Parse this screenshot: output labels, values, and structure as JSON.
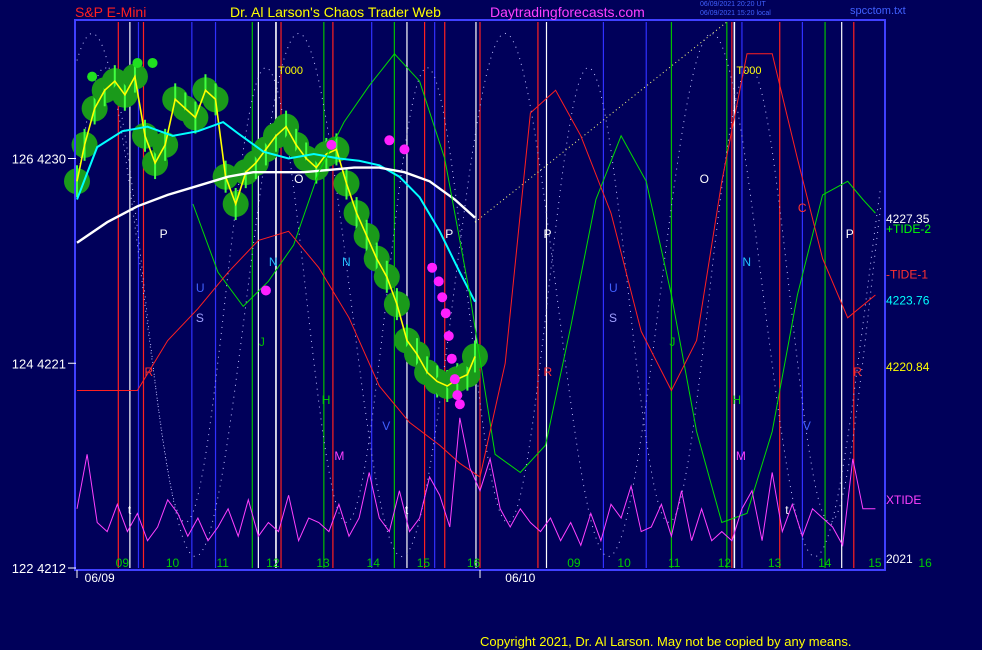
{
  "header": {
    "symbol": "S&P E-Mini",
    "site": "Dr. Al Larson's Chaos Trader Web",
    "url": "Daytradingforecasts.com",
    "file": "spcctom.txt",
    "stamp1": "06/09/2021 20:20 UT",
    "stamp2": "06/09/2021 15:20 local"
  },
  "copyright": "Copyright 2021, Dr. Al Larson. May not be copied by any means.",
  "colors": {
    "background": "#00005a",
    "frame": "#4040ff",
    "price": "#ffff00",
    "ma_fast": "#00ffff",
    "ma_slow": "#ffffff",
    "tide_plus": "#00dd00",
    "tide_minus": "#ff2020",
    "xtide": "#ff40ff",
    "highlight": "#00cc00"
  },
  "chart_data": {
    "type": "line",
    "title": "S&P E-Mini",
    "ylim": [
      4212,
      4236
    ],
    "y_ticks": [
      {
        "value": 4230,
        "label": "126  4230"
      },
      {
        "value": 4221,
        "label": "124  4221"
      },
      {
        "value": 4212,
        "label": "122  4212"
      }
    ],
    "x_hour_labels": [
      "09",
      "10",
      "11",
      "12",
      "13",
      "14",
      "15",
      "16",
      "09",
      "10",
      "11",
      "12",
      "13",
      "14",
      "15",
      "16"
    ],
    "x_date_labels": [
      "06/09",
      "06/10"
    ],
    "right_labels": [
      {
        "text": "4227.35",
        "value": 4227.35,
        "color": "#ffffff"
      },
      {
        "text": "+TIDE-2",
        "value": 4226.9,
        "color": "#00ff00"
      },
      {
        "text": "-TIDE-1",
        "value": 4224.9,
        "color": "#ff3030"
      },
      {
        "text": "4223.76",
        "value": 4223.76,
        "color": "#00ffff"
      },
      {
        "text": "4220.84",
        "value": 4220.84,
        "color": "#ffff00"
      },
      {
        "text": "XTIDE",
        "value": 4215.0,
        "color": "#ff40ff"
      },
      {
        "text": "2021",
        "value": 4212.4,
        "color": "#ffffff"
      }
    ],
    "day_boundary_labels": [
      "T000",
      "T000"
    ],
    "vline_letters": [
      {
        "t": 1.58,
        "letter": "P",
        "color": "#ffffff"
      },
      {
        "t": 2.3,
        "letter": "U",
        "color": "#4060ff"
      },
      {
        "t": 2.3,
        "letter": "S",
        "color": "#a0a0ff"
      },
      {
        "t": 1.28,
        "letter": "R",
        "color": "#ff3030"
      },
      {
        "t": 3.55,
        "letter": "J",
        "color": "#00c000"
      },
      {
        "t": 3.75,
        "letter": "N",
        "color": "#20c0ff"
      },
      {
        "t": 4.25,
        "letter": "O",
        "color": "#ffffff"
      },
      {
        "t": 4.8,
        "letter": "H",
        "color": "#00d000"
      },
      {
        "t": 5.05,
        "letter": "M",
        "color": "#ff40ff"
      },
      {
        "t": 5.2,
        "letter": "N",
        "color": "#20c0ff"
      },
      {
        "t": 6.0,
        "letter": "V",
        "color": "#4060ff"
      },
      {
        "t": 7.25,
        "letter": "P",
        "color": "#ffffff"
      },
      {
        "t": 9.2,
        "letter": "P",
        "color": "#ffffff"
      },
      {
        "t": 9.2,
        "letter": "R",
        "color": "#ff3030"
      },
      {
        "t": 10.5,
        "letter": "U",
        "color": "#4060ff"
      },
      {
        "t": 10.5,
        "letter": "S",
        "color": "#a0a0ff"
      },
      {
        "t": 11.7,
        "letter": "J",
        "color": "#00c000"
      },
      {
        "t": 12.3,
        "letter": "O",
        "color": "#ffffff"
      },
      {
        "t": 12.95,
        "letter": "H",
        "color": "#00d000"
      },
      {
        "t": 13.02,
        "letter": "M",
        "color": "#ff40ff"
      },
      {
        "t": 13.15,
        "letter": "N",
        "color": "#20c0ff"
      },
      {
        "t": 14.25,
        "letter": "C",
        "color": "#ff3030"
      },
      {
        "t": 14.35,
        "letter": "V",
        "color": "#4060ff"
      },
      {
        "t": 15.2,
        "letter": "P",
        "color": "#ffffff"
      },
      {
        "t": 15.35,
        "letter": "R",
        "color": "#ff3030"
      },
      {
        "t": 0.95,
        "letter": "t",
        "color": "#ffffff"
      },
      {
        "t": 6.45,
        "letter": "t",
        "color": "#ffffff"
      },
      {
        "t": 14.0,
        "letter": "t",
        "color": "#ffffff"
      }
    ],
    "vlines": [
      {
        "t": 0.82,
        "color": "#ff2020"
      },
      {
        "t": 1.05,
        "color": "#ffffff"
      },
      {
        "t": 1.22,
        "color": "#3030ff"
      },
      {
        "t": 1.32,
        "color": "#ff2020"
      },
      {
        "t": 2.28,
        "color": "#3030ff"
      },
      {
        "t": 2.75,
        "color": "#3030ff"
      },
      {
        "t": 3.48,
        "color": "#00c000"
      },
      {
        "t": 3.6,
        "color": "#ffffff"
      },
      {
        "t": 3.95,
        "color": "#ffffff"
      },
      {
        "t": 4.05,
        "color": "#ff2020"
      },
      {
        "t": 4.9,
        "color": "#00c000"
      },
      {
        "t": 5.08,
        "color": "#ff2020"
      },
      {
        "t": 5.85,
        "color": "#3030ff"
      },
      {
        "t": 6.3,
        "color": "#00c000"
      },
      {
        "t": 6.55,
        "color": "#ffffff"
      },
      {
        "t": 6.9,
        "color": "#ff2020"
      },
      {
        "t": 7.1,
        "color": "#3030ff"
      },
      {
        "t": 7.3,
        "color": "#ff2020"
      },
      {
        "t": 7.92,
        "color": "#ffffff"
      },
      {
        "t": 8.0,
        "color": "#ff2020"
      },
      {
        "t": 9.15,
        "color": "#ff2020"
      },
      {
        "t": 9.32,
        "color": "#ffffff"
      },
      {
        "t": 10.45,
        "color": "#3030ff"
      },
      {
        "t": 11.3,
        "color": "#3030ff"
      },
      {
        "t": 11.8,
        "color": "#00c000"
      },
      {
        "t": 12.9,
        "color": "#00c000"
      },
      {
        "t": 13.0,
        "color": "#ff2020"
      },
      {
        "t": 13.05,
        "color": "#ffffff"
      },
      {
        "t": 13.2,
        "color": "#3030ff"
      },
      {
        "t": 13.95,
        "color": "#ff2020"
      },
      {
        "t": 14.4,
        "color": "#3030ff"
      },
      {
        "t": 14.85,
        "color": "#00c000"
      },
      {
        "t": 15.18,
        "color": "#ffffff"
      },
      {
        "t": 15.42,
        "color": "#ff2020"
      }
    ],
    "series": [
      {
        "name": "Price",
        "x": [
          0.0,
          0.15,
          0.35,
          0.55,
          0.75,
          0.95,
          1.15,
          1.35,
          1.55,
          1.75,
          1.95,
          2.15,
          2.35,
          2.55,
          2.75,
          2.95,
          3.15,
          3.35,
          3.55,
          3.75,
          3.95,
          4.15,
          4.35,
          4.55,
          4.75,
          4.95,
          5.15,
          5.35,
          5.55,
          5.75,
          5.95,
          6.15,
          6.35,
          6.55,
          6.75,
          6.95,
          7.15,
          7.35,
          7.55,
          7.75,
          7.9
        ],
        "values": [
          4229.0,
          4230.6,
          4232.2,
          4233.0,
          4233.4,
          4232.8,
          4233.6,
          4231.0,
          4229.8,
          4230.6,
          4232.6,
          4232.2,
          4231.8,
          4233.0,
          4232.6,
          4229.2,
          4228.0,
          4229.4,
          4229.8,
          4230.4,
          4231.0,
          4231.4,
          4230.6,
          4230.0,
          4229.6,
          4230.2,
          4230.4,
          4228.9,
          4227.6,
          4226.6,
          4225.6,
          4224.8,
          4223.6,
          4222.0,
          4221.4,
          4220.6,
          4220.2,
          4220.0,
          4220.3,
          4220.5,
          4221.3
        ]
      },
      {
        "name": "Fast MA",
        "x": [
          0.0,
          0.4,
          0.9,
          1.4,
          1.9,
          2.4,
          2.9,
          3.2,
          3.7,
          4.2,
          4.7,
          5.2,
          5.6,
          6.0,
          6.4,
          6.8,
          7.2,
          7.6,
          7.9
        ],
        "values": [
          4228.2,
          4230.5,
          4231.2,
          4231.4,
          4231.0,
          4231.2,
          4231.6,
          4231.1,
          4230.3,
          4230.0,
          4230.2,
          4230.0,
          4229.9,
          4229.7,
          4229.2,
          4228.3,
          4226.8,
          4225.0,
          4223.7
        ]
      },
      {
        "name": "Slow MA",
        "x": [
          0.0,
          0.6,
          1.2,
          1.8,
          2.4,
          3.0,
          3.5,
          4.0,
          4.5,
          5.0,
          5.5,
          6.0,
          6.5,
          7.0,
          7.5,
          7.9
        ],
        "values": [
          4226.3,
          4227.2,
          4227.9,
          4228.4,
          4228.8,
          4229.2,
          4229.4,
          4229.4,
          4229.4,
          4229.5,
          4229.6,
          4229.6,
          4229.4,
          4229.0,
          4228.2,
          4227.4
        ]
      },
      {
        "name": "+TIDE-2",
        "x": [
          2.3,
          2.8,
          3.3,
          3.8,
          4.3,
          4.8,
          5.3,
          5.8,
          6.3,
          6.8,
          7.3,
          7.8,
          8.3,
          8.8,
          9.3,
          9.8,
          10.3,
          10.8,
          11.3,
          11.8,
          12.3,
          12.8,
          13.3,
          13.8,
          14.3,
          14.8,
          15.3,
          15.6,
          15.85
        ],
        "values": [
          4228.0,
          4225.0,
          4223.5,
          4224.6,
          4226.2,
          4229.4,
          4231.6,
          4233.2,
          4234.6,
          4233.4,
          4230.0,
          4224.0,
          4217.0,
          4216.2,
          4217.4,
          4222.6,
          4228.2,
          4231.0,
          4229.0,
          4224.0,
          4218.0,
          4214.0,
          4214.4,
          4218.0,
          4224.0,
          4228.4,
          4229.0,
          4228.2,
          4227.6
        ]
      },
      {
        "name": "-TIDE-1",
        "x": [
          0.0,
          0.6,
          1.2,
          1.8,
          2.4,
          3.0,
          3.6,
          4.2,
          4.8,
          5.4,
          6.0,
          6.6,
          7.2,
          7.6,
          8.0,
          8.5,
          9.0,
          9.5,
          10.0,
          10.6,
          11.2,
          11.8,
          12.3,
          12.8,
          13.3,
          13.8,
          14.3,
          14.8,
          15.3,
          15.85
        ],
        "values": [
          4219.8,
          4219.8,
          4219.8,
          4222.0,
          4223.4,
          4225.0,
          4226.4,
          4226.8,
          4225.2,
          4223.0,
          4220.0,
          4218.4,
          4217.4,
          4216.6,
          4216.0,
          4221.0,
          4232.0,
          4233.0,
          4231.0,
          4227.6,
          4222.4,
          4219.8,
          4222.0,
          4229.0,
          4234.6,
          4234.6,
          4230.0,
          4225.6,
          4223.0,
          4224.0
        ]
      },
      {
        "name": "XTIDE",
        "x": [
          0.0,
          0.2,
          0.4,
          0.6,
          0.8,
          1.0,
          1.2,
          1.4,
          1.6,
          1.8,
          2.0,
          2.2,
          2.4,
          2.6,
          2.8,
          3.0,
          3.2,
          3.4,
          3.6,
          3.8,
          4.0,
          4.2,
          4.4,
          4.6,
          4.8,
          5.0,
          5.2,
          5.4,
          5.6,
          5.8,
          6.0,
          6.2,
          6.4,
          6.6,
          6.8,
          7.0,
          7.2,
          7.4,
          7.6,
          7.8,
          8.0,
          8.2,
          8.4,
          8.6,
          8.8,
          9.0,
          9.2,
          9.4,
          9.6,
          9.8,
          10.0,
          10.2,
          10.4,
          10.6,
          10.8,
          11.0,
          11.2,
          11.4,
          11.6,
          11.8,
          12.0,
          12.2,
          12.4,
          12.6,
          12.8,
          13.0,
          13.2,
          13.4,
          13.6,
          13.8,
          14.0,
          14.2,
          14.4,
          14.6,
          14.8,
          15.0,
          15.2,
          15.4,
          15.6,
          15.85
        ],
        "values": [
          4214.6,
          4217.0,
          4214.0,
          4213.6,
          4214.8,
          4213.6,
          4214.4,
          4213.2,
          4213.8,
          4215.0,
          4214.4,
          4213.4,
          4214.2,
          4213.2,
          4213.8,
          4214.6,
          4213.4,
          4215.0,
          4213.4,
          4214.0,
          4213.6,
          4215.2,
          4213.2,
          4214.2,
          4214.0,
          4213.6,
          4214.8,
          4213.4,
          4214.2,
          4216.2,
          4214.2,
          4213.6,
          4215.4,
          4213.6,
          4214.2,
          4216.0,
          4215.2,
          4213.8,
          4218.6,
          4216.4,
          4215.4,
          4216.8,
          4214.6,
          4213.8,
          4214.6,
          4214.0,
          4213.6,
          4214.2,
          4213.2,
          4214.0,
          4213.0,
          4214.4,
          4213.2,
          4214.8,
          4214.2,
          4215.6,
          4213.6,
          4213.8,
          4214.8,
          4213.4,
          4215.4,
          4213.2,
          4214.6,
          4213.2,
          4213.6,
          4213.2,
          4214.6,
          4215.4,
          4213.2,
          4216.2,
          4213.6,
          4214.8,
          4213.4,
          4214.6,
          4214.2,
          4213.8,
          4213.0,
          4216.8,
          4214.6,
          4214.6
        ]
      }
    ],
    "markers_magenta": [
      {
        "x": 3.75,
        "y": 4224.2
      },
      {
        "x": 7.05,
        "y": 4225.2
      },
      {
        "x": 7.18,
        "y": 4224.6
      },
      {
        "x": 7.25,
        "y": 4223.9
      },
      {
        "x": 7.32,
        "y": 4223.2
      },
      {
        "x": 7.38,
        "y": 4222.2
      },
      {
        "x": 7.44,
        "y": 4221.2
      },
      {
        "x": 7.5,
        "y": 4220.3
      },
      {
        "x": 7.55,
        "y": 4219.6
      },
      {
        "x": 7.6,
        "y": 4219.2
      },
      {
        "x": 6.2,
        "y": 4230.8
      },
      {
        "x": 6.5,
        "y": 4230.4
      },
      {
        "x": 5.05,
        "y": 4230.6
      }
    ],
    "markers_green": [
      {
        "x": 0.3,
        "y": 4233.6
      },
      {
        "x": 1.2,
        "y": 4234.2
      },
      {
        "x": 1.5,
        "y": 4234.2
      }
    ]
  }
}
